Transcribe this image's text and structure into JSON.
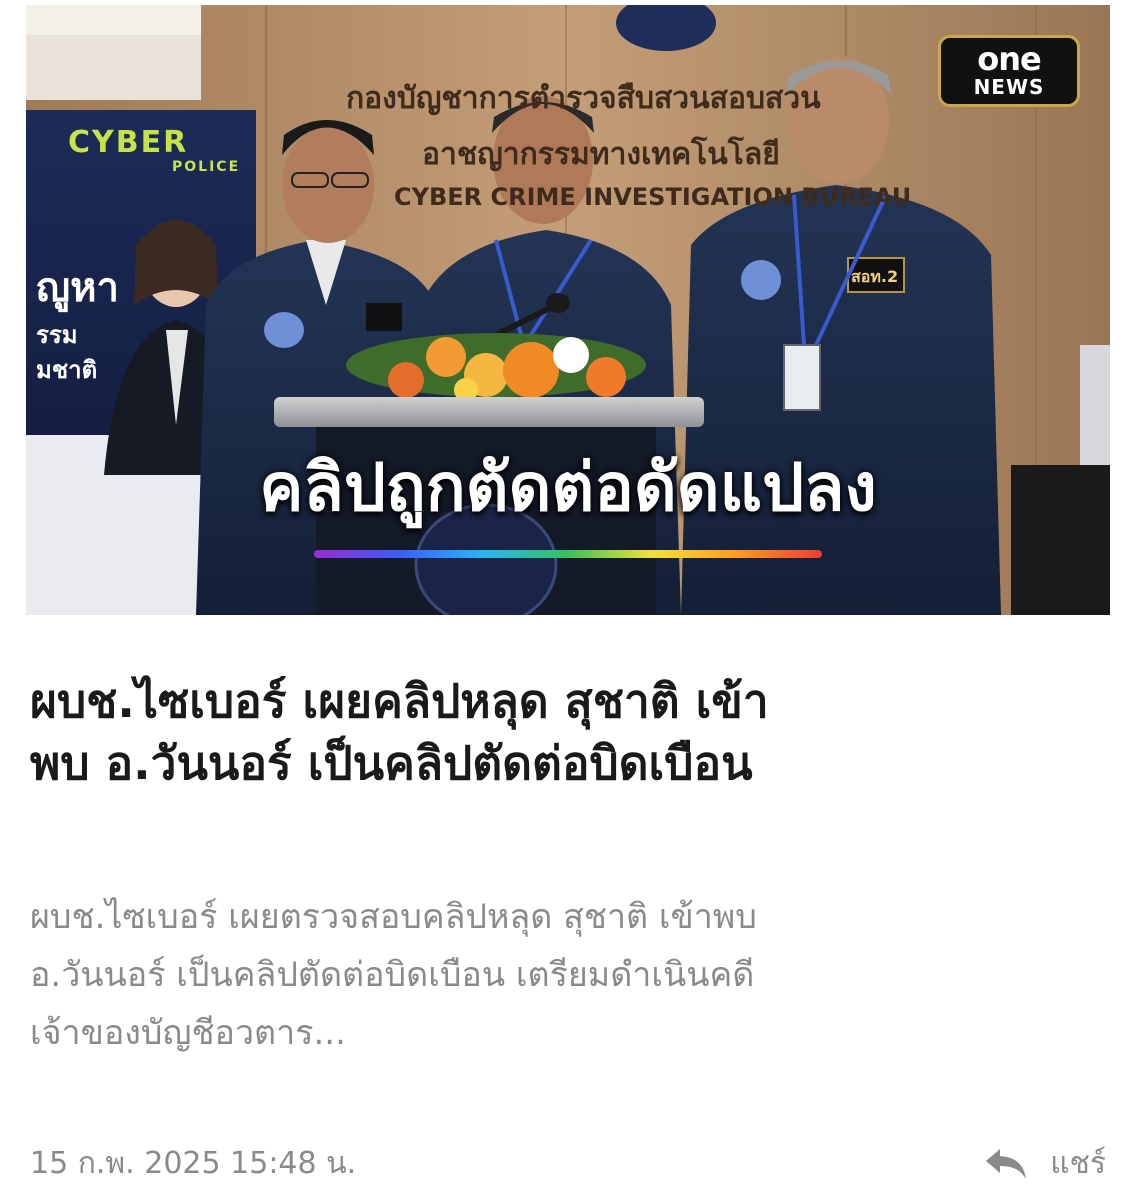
{
  "image": {
    "alt": "",
    "brand_top": "one",
    "brand_bottom": "NEWS",
    "sign_line1": "กองบัญชาการตำรวจสืบสวนสอบสวน",
    "sign_line2": "อาชญากรรมทางเทคโนโลยี",
    "sign_line3": "CYBER CRIME INVESTIGATION BUREAU",
    "banner_logo": "CYBER",
    "banner_logo_sub": "POLICE",
    "banner_word1": "ญูหา",
    "banner_word2": "รรม",
    "banner_word3": "มชาติ",
    "badge_text": "สอท.2",
    "overlay_caption": "คลิปถูกตัดต่อดัดแปลง"
  },
  "article": {
    "headline_line1": "ผบช.ไซเบอร์ เผยคลิปหลุด สุชาติ เข้า",
    "headline_line2": "พบ อ.วันนอร์ เป็นคลิปตัดต่อบิดเบือน",
    "summary_line1": "ผบช.ไซเบอร์ เผยตรวจสอบคลิปหลุด สุชาติ เข้าพบ",
    "summary_line2": "อ.วันนอร์ เป็นคลิปตัดต่อบิดเบือน เตรียมดำเนินคดี",
    "summary_line3": "เจ้าของบัญชีอวตาร..."
  },
  "footer": {
    "date": "15 ก.พ. 2025 15:48 น.",
    "share_label": "แชร์",
    "share_icon": "share-arrow-icon"
  },
  "colors": {
    "headline": "#1a1a1a",
    "muted_text": "#8a8a8a",
    "brand_border": "#caa74a"
  }
}
